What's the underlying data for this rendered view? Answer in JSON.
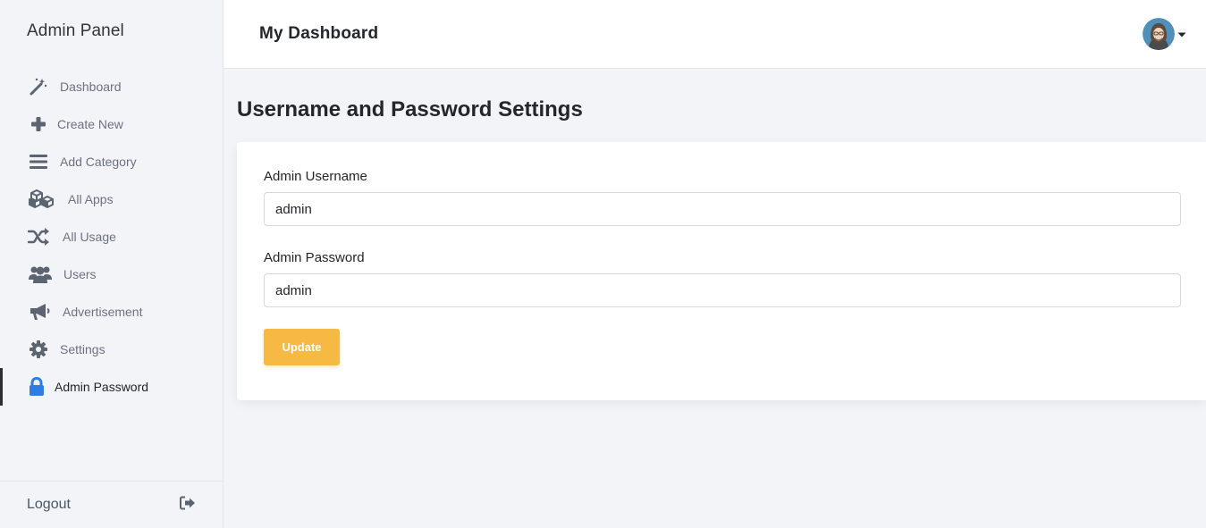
{
  "sidebar": {
    "brand": "Admin Panel",
    "items": [
      {
        "label": "Dashboard",
        "icon": "magic-wand-icon"
      },
      {
        "label": "Create New",
        "icon": "plus-icon"
      },
      {
        "label": "Add Category",
        "icon": "bars-icon"
      },
      {
        "label": "All Apps",
        "icon": "cubes-icon"
      },
      {
        "label": "All Usage",
        "icon": "shuffle-icon"
      },
      {
        "label": "Users",
        "icon": "users-icon"
      },
      {
        "label": "Advertisement",
        "icon": "megaphone-icon"
      },
      {
        "label": "Settings",
        "icon": "gear-icon"
      },
      {
        "label": "Admin Password",
        "icon": "lock-icon",
        "active": true
      }
    ],
    "logout_label": "Logout"
  },
  "header": {
    "title": "My Dashboard"
  },
  "main": {
    "section_title": "Username and Password Settings",
    "form": {
      "username_label": "Admin Username",
      "username_value": "admin",
      "password_label": "Admin Password",
      "password_value": "admin",
      "submit_label": "Update"
    }
  },
  "colors": {
    "accent": "#f5b944",
    "active_icon": "#2f7de1",
    "icon": "#5b6470",
    "background": "#f3f4f7"
  }
}
